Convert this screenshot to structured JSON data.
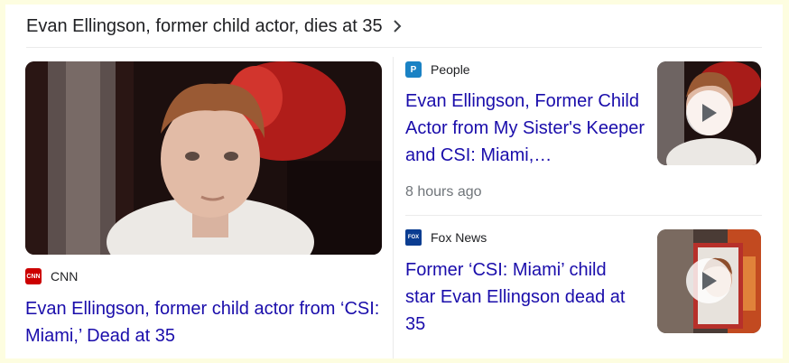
{
  "header": {
    "title": "Evan Ellingson, former child actor, dies at 35"
  },
  "main_story": {
    "image": "photo-of-young-man",
    "source": {
      "name": "CNN",
      "logo_text": "CNN",
      "logo_color": "#cc0000"
    },
    "headline": "Evan Ellingson, former child actor from ‘CSI: Miami,’ Dead at 35"
  },
  "stories": [
    {
      "source": {
        "name": "People",
        "logo_text": "P",
        "logo_color": "#1a82c4"
      },
      "headline": "Evan Ellingson, Former Child Actor from My Sister's Keeper and CSI: Miami,…",
      "time": "8 hours ago",
      "thumb_icon": "play-icon"
    },
    {
      "source": {
        "name": "Fox News",
        "logo_text": "FOX",
        "logo_color": "#0b3d91"
      },
      "headline": "Former ‘CSI: Miami’ child star Evan Ellingson dead at 35",
      "thumb_icon": "play-icon"
    }
  ],
  "colors": {
    "link": "#1a0dab",
    "text": "#202124",
    "muted": "#70757a",
    "background": "#fdfde0"
  }
}
